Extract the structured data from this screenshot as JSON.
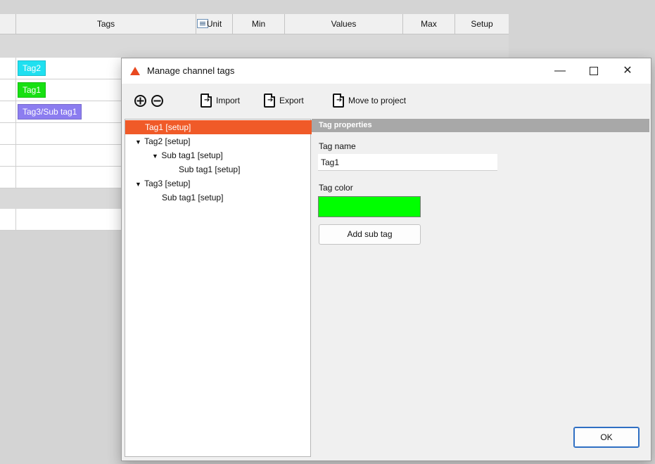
{
  "table": {
    "columns": [
      "Tags",
      "Unit",
      "Min",
      "Values",
      "Max",
      "Setup"
    ],
    "rows": [
      {
        "tag": "Tag2",
        "color": "#1fe0f0"
      },
      {
        "tag": "Tag1",
        "color": "#17e012"
      },
      {
        "tag": "Tag3/Sub tag1",
        "color": "#8c7df0"
      }
    ]
  },
  "dialog": {
    "title": "Manage channel tags",
    "window_controls": {
      "minimize": "—",
      "close": "✕"
    },
    "toolbar": {
      "add_icon": "⊕",
      "remove_icon": "⊖",
      "import_label": "Import",
      "export_label": "Export",
      "move_label": "Move to project"
    },
    "tree": [
      {
        "label": "Tag1 [setup]",
        "selected": true,
        "expanded": null
      },
      {
        "label": "Tag2 [setup]",
        "selected": false,
        "expanded": true
      },
      {
        "label": "Sub tag1 [setup]",
        "selected": false,
        "expanded": true
      },
      {
        "label": "Sub tag1 [setup]",
        "selected": false,
        "expanded": null
      },
      {
        "label": "Tag3 [setup]",
        "selected": false,
        "expanded": true
      },
      {
        "label": "Sub tag1 [setup]",
        "selected": false,
        "expanded": null
      }
    ],
    "tree_arrow": "▼",
    "properties": {
      "header": "Tag properties",
      "name_label": "Tag name",
      "name_value": "Tag1",
      "color_label": "Tag color",
      "color_value": "#00ff00",
      "add_sub_tag_label": "Add sub tag"
    },
    "ok_label": "OK"
  }
}
